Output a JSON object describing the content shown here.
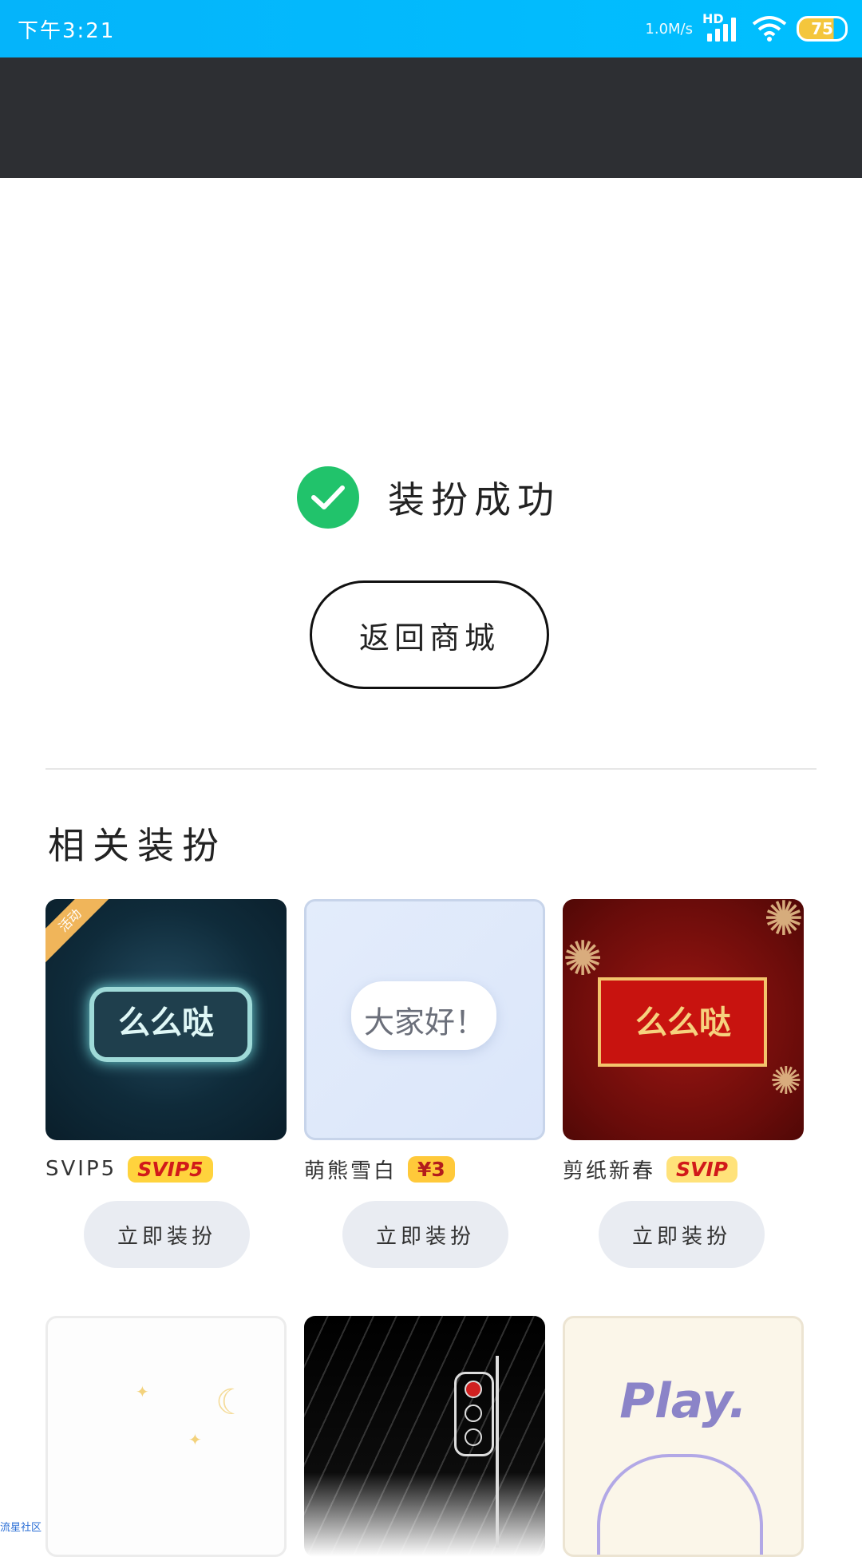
{
  "status_bar": {
    "time": "下午3:21",
    "net_speed": "1.0M/s",
    "network_badge": "HD",
    "battery": "75",
    "icons": [
      "signal-icon",
      "wifi-icon",
      "battery-icon"
    ]
  },
  "success": {
    "icon": "check-circle-icon",
    "message": "装扮成功",
    "color": "#21c36b"
  },
  "back_button": {
    "label": "返回商城"
  },
  "related": {
    "title": "相关装扮",
    "items": [
      {
        "thumb_text": "么么哒",
        "corner_tag": "活动",
        "name": "SVIP5",
        "badge": "SVIP5",
        "action": "立即装扮"
      },
      {
        "thumb_text": "大家好！",
        "name": "萌熊雪白",
        "badge": "¥3",
        "action": "立即装扮"
      },
      {
        "thumb_text": "么么哒",
        "name": "剪纸新春",
        "badge": "SVIP",
        "action": "立即装扮"
      },
      {
        "thumb_text": ""
      },
      {
        "thumb_text": ""
      },
      {
        "thumb_text": "Play."
      }
    ]
  },
  "watermark": "流星社区"
}
